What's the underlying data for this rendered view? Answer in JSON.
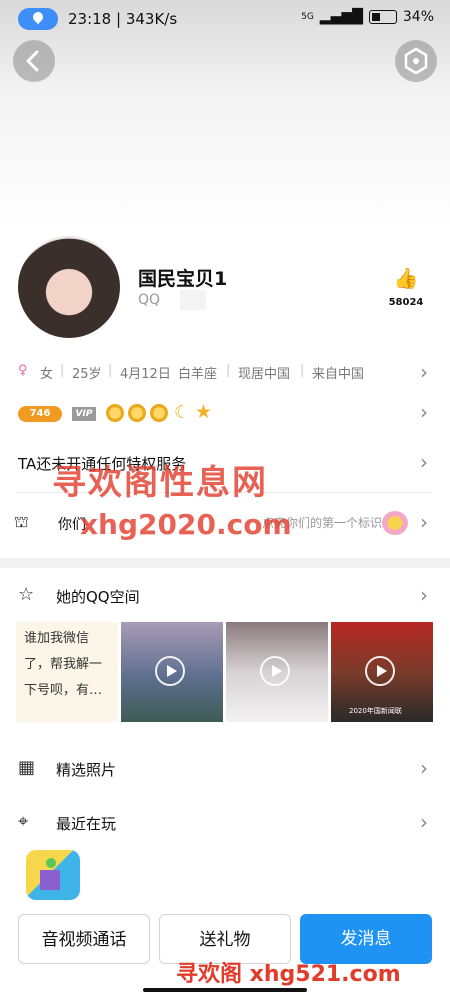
{
  "status_bar": {
    "time_speed": "23:18 | 343K/s",
    "battery": "34%",
    "network": "5G"
  },
  "profile": {
    "name": "国民宝贝1",
    "qq_label": "QQ",
    "likes": "58024"
  },
  "info": {
    "gender_symbol": "♀",
    "gender": "女",
    "age": "25岁",
    "birthday": "4月12日",
    "zodiac": "白羊座",
    "residence": "现居中国",
    "origin": "来自中国",
    "separator": "|"
  },
  "badges": {
    "level": "746",
    "vip": "VIP"
  },
  "privilege": {
    "text": "TA还未开通任何特权服务"
  },
  "mark": {
    "left_text": "你们",
    "right_text": "点亮你们的第一个标识"
  },
  "qzone": {
    "title": "她的QQ空间",
    "post_text": "谁加我微信了，帮我解一下号呗，有…",
    "video_caption": "2020年国新闻联"
  },
  "photos": {
    "title": "精选照片"
  },
  "recent": {
    "title": "最近在玩"
  },
  "actions": {
    "call": "音视频通话",
    "gift": "送礼物",
    "message": "发消息"
  },
  "watermarks": {
    "w1": "寻欢阁性息网",
    "w2": "xhg2020.com",
    "w3": "寻欢阁 xhg521.com"
  },
  "colors": {
    "accent_blue": "#1e93f3",
    "watermark_red": "#e23b2a",
    "gold": "#f0b323"
  }
}
